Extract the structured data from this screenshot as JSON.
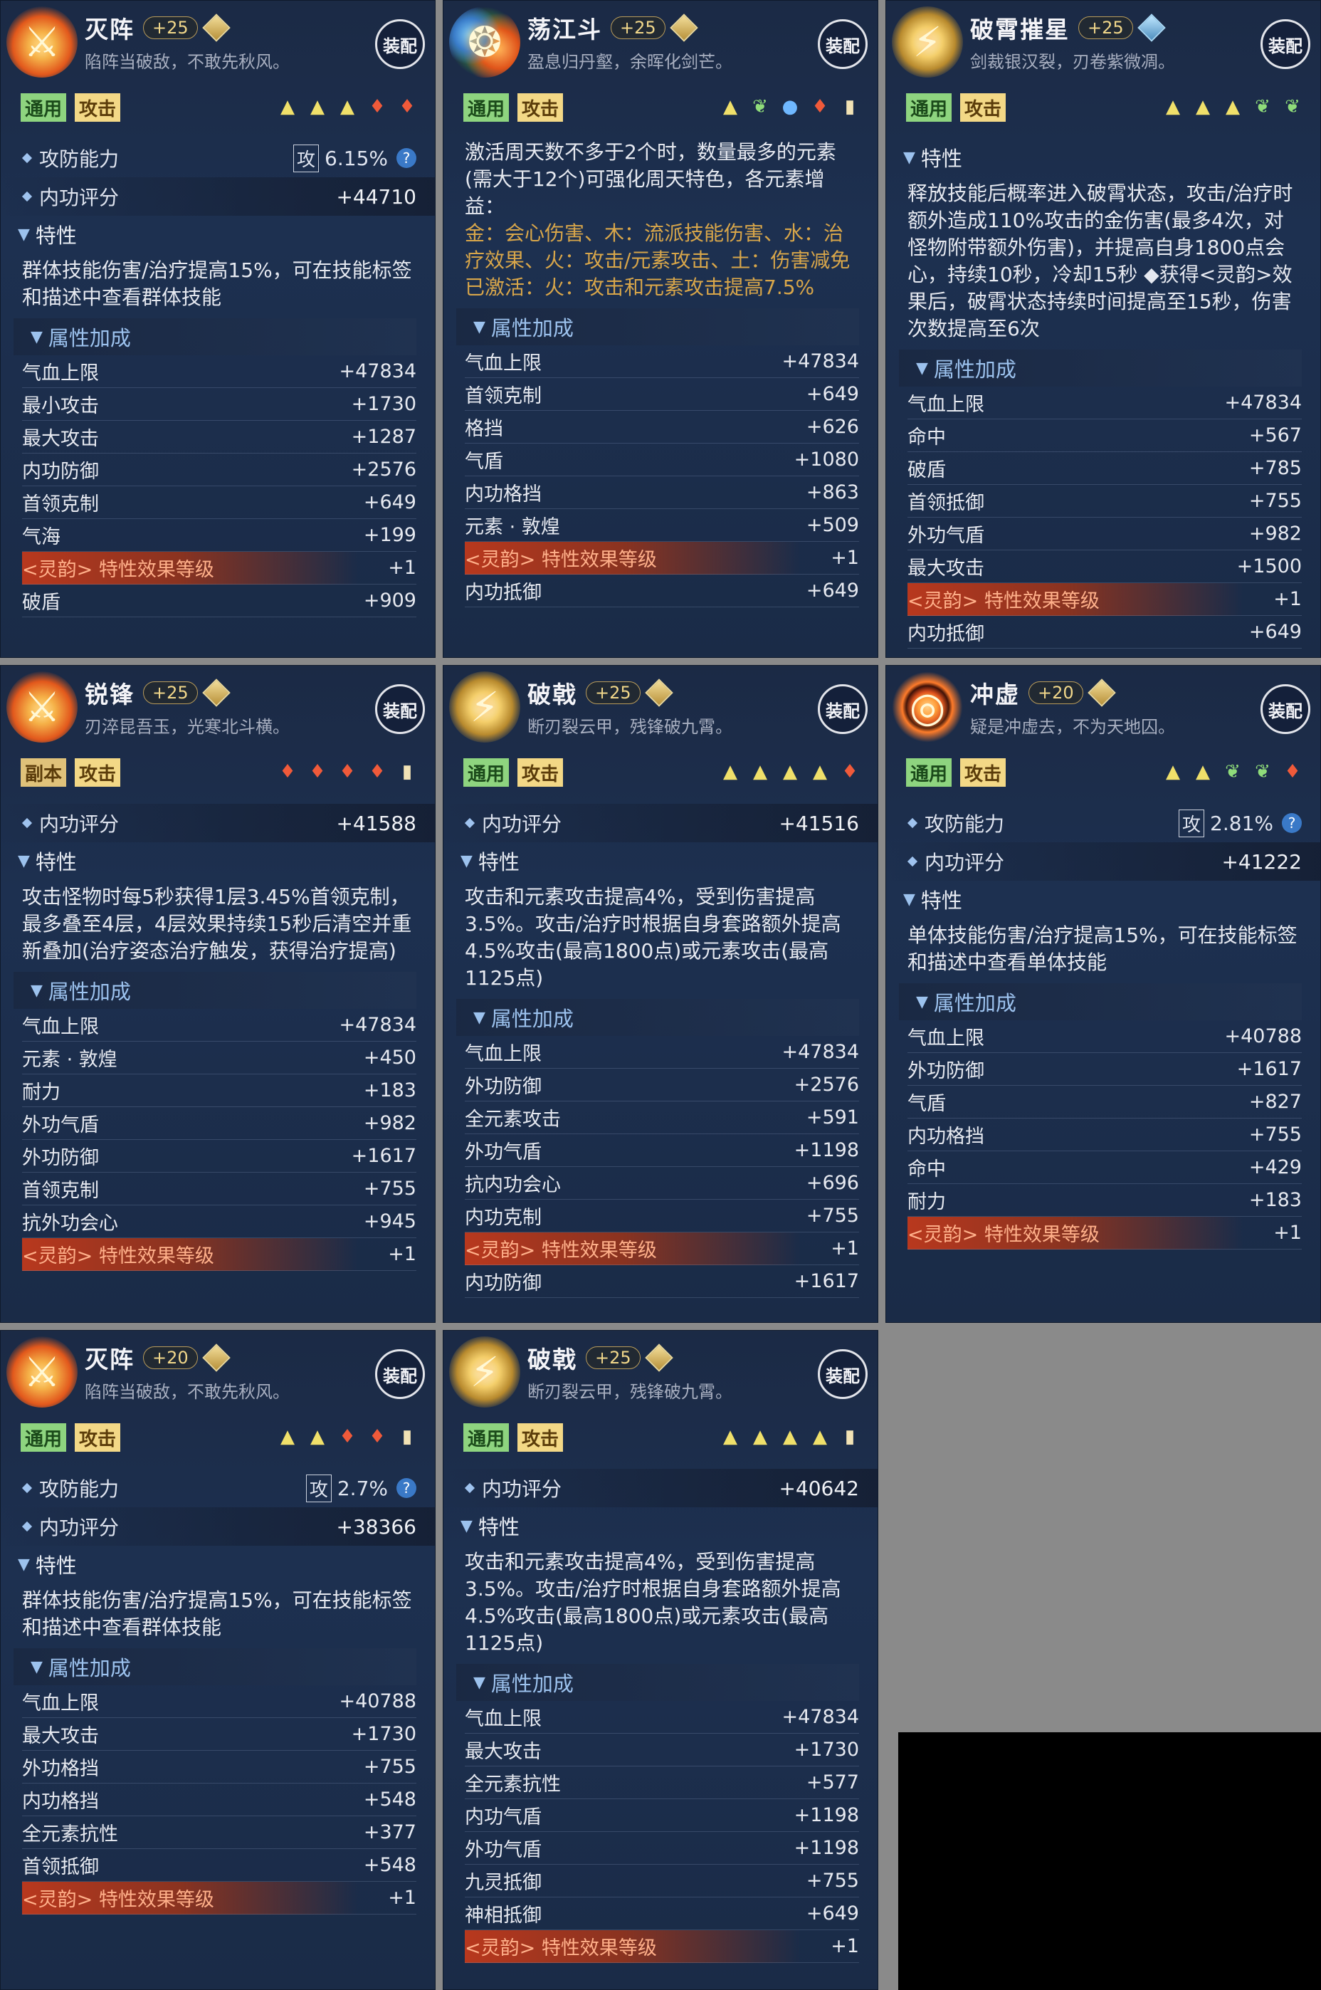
{
  "cards": [
    {
      "name": "灭阵",
      "level": "+25",
      "desc": "陷阵当破敌，不敢先秋风。",
      "equip": "装配",
      "tags": [
        "通用",
        "攻击"
      ],
      "icons": [
        "tri",
        "tri",
        "tri",
        "fire",
        "fire"
      ],
      "atk_ability": {
        "label": "攻防能力",
        "box": "攻",
        "value": "6.15%"
      },
      "score": {
        "label": "内功评分",
        "value": "+44710"
      },
      "trait_label": "特性",
      "trait_text": "群体技能伤害/治疗提高15%，可在技能标签和描述中查看群体技能",
      "bonus_label": "属性加成",
      "attrs": [
        {
          "k": "气血上限",
          "v": "+47834"
        },
        {
          "k": "最小攻击",
          "v": "+1730"
        },
        {
          "k": "最大攻击",
          "v": "+1287"
        },
        {
          "k": "内功防御",
          "v": "+2576"
        },
        {
          "k": "首领克制",
          "v": "+649"
        },
        {
          "k": "气海",
          "v": "+199"
        },
        {
          "k": "<灵韵> 特性效果等级",
          "v": "+1",
          "fx": true
        },
        {
          "k": "破盾",
          "v": "+909"
        }
      ]
    },
    {
      "name": "荡江斗",
      "level": "+25",
      "desc": "盈息归丹壑，余晖化剑芒。",
      "equip": "装配",
      "tags": [
        "通用",
        "攻击"
      ],
      "icons": [
        "tri",
        "leaf",
        "drop",
        "fire",
        "stone"
      ],
      "trait_text_lines": [
        "激活周天数不多于2个时，数量最多的元素",
        "(需大于12个)可强化周天特色，各元素增益：",
        "金：会心伤害、木：流派技能伤害、水：治疗效果、火：攻击/元素攻击、土：伤害减免",
        "已激活：火：攻击和元素攻击提高7.5%"
      ],
      "bonus_label": "属性加成",
      "attrs": [
        {
          "k": "气血上限",
          "v": "+47834"
        },
        {
          "k": "首领克制",
          "v": "+649"
        },
        {
          "k": "格挡",
          "v": "+626"
        },
        {
          "k": "气盾",
          "v": "+1080"
        },
        {
          "k": "内功格挡",
          "v": "+863"
        },
        {
          "k": "元素 · 敦煌",
          "v": "+509"
        },
        {
          "k": "<灵韵> 特性效果等级",
          "v": "+1",
          "fx": true
        },
        {
          "k": "内功抵御",
          "v": "+649"
        }
      ]
    },
    {
      "name": "破霄摧星",
      "level": "+25",
      "desc": "剑裁银汉裂，刃卷紫微凋。",
      "equip": "装配",
      "tags": [
        "通用",
        "攻击"
      ],
      "icons": [
        "tri",
        "tri",
        "tri",
        "leaf",
        "leaf"
      ],
      "trait_label": "特性",
      "trait_text": "释放技能后概率进入破霄状态，攻击/治疗时额外造成110%攻击的金伤害(最多4次，对怪物附带额外伤害)，并提高自身1800点会心，持续10秒，冷却15秒 ◆获得<灵韵>效果后，破霄状态持续时间提高至15秒，伤害次数提高至6次",
      "bonus_label": "属性加成",
      "attrs": [
        {
          "k": "气血上限",
          "v": "+47834"
        },
        {
          "k": "命中",
          "v": "+567"
        },
        {
          "k": "破盾",
          "v": "+785"
        },
        {
          "k": "首领抵御",
          "v": "+755"
        },
        {
          "k": "外功气盾",
          "v": "+982"
        },
        {
          "k": "最大攻击",
          "v": "+1500"
        },
        {
          "k": "<灵韵> 特性效果等级",
          "v": "+1",
          "fx": true
        },
        {
          "k": "内功抵御",
          "v": "+649"
        }
      ]
    },
    {
      "name": "锐锋",
      "level": "+25",
      "desc": "刃淬昆吾玉，光寒北斗横。",
      "equip": "装配",
      "tags": [
        "副本",
        "攻击"
      ],
      "icons": [
        "fire",
        "fire",
        "fire",
        "fire",
        "stone"
      ],
      "score": {
        "label": "内功评分",
        "value": "+41588"
      },
      "trait_label": "特性",
      "trait_text": "攻击怪物时每5秒获得1层3.45%首领克制，最多叠至4层，4层效果持续15秒后清空并重新叠加(治疗姿态治疗触发，获得治疗提高)",
      "bonus_label": "属性加成",
      "attrs": [
        {
          "k": "气血上限",
          "v": "+47834"
        },
        {
          "k": "元素 · 敦煌",
          "v": "+450"
        },
        {
          "k": "耐力",
          "v": "+183"
        },
        {
          "k": "外功气盾",
          "v": "+982"
        },
        {
          "k": "外功防御",
          "v": "+1617"
        },
        {
          "k": "首领克制",
          "v": "+755"
        },
        {
          "k": "抗外功会心",
          "v": "+945"
        },
        {
          "k": "<灵韵> 特性效果等级",
          "v": "+1",
          "fx": true
        }
      ]
    },
    {
      "name": "破戟",
      "level": "+25",
      "desc": "断刃裂云甲，残锋破九霄。",
      "equip": "装配",
      "tags": [
        "通用",
        "攻击"
      ],
      "icons": [
        "tri",
        "tri",
        "tri",
        "tri",
        "fire"
      ],
      "score": {
        "label": "内功评分",
        "value": "+41516"
      },
      "trait_label": "特性",
      "trait_text": "攻击和元素攻击提高4%，受到伤害提高3.5%。攻击/治疗时根据自身套路额外提高4.5%攻击(最高1800点)或元素攻击(最高1125点)",
      "bonus_label": "属性加成",
      "attrs": [
        {
          "k": "气血上限",
          "v": "+47834"
        },
        {
          "k": "外功防御",
          "v": "+2576"
        },
        {
          "k": "全元素攻击",
          "v": "+591"
        },
        {
          "k": "外功气盾",
          "v": "+1198"
        },
        {
          "k": "抗内功会心",
          "v": "+696"
        },
        {
          "k": "内功克制",
          "v": "+755"
        },
        {
          "k": "<灵韵> 特性效果等级",
          "v": "+1",
          "fx": true
        },
        {
          "k": "内功防御",
          "v": "+1617"
        }
      ]
    },
    {
      "name": "冲虚",
      "level": "+20",
      "desc": "疑是冲虚去，不为天地囚。",
      "equip": "装配",
      "tags": [
        "通用",
        "攻击"
      ],
      "icons": [
        "tri",
        "tri",
        "leaf",
        "leaf",
        "fire"
      ],
      "atk_ability": {
        "label": "攻防能力",
        "box": "攻",
        "value": "2.81%"
      },
      "score": {
        "label": "内功评分",
        "value": "+41222"
      },
      "trait_label": "特性",
      "trait_text": "单体技能伤害/治疗提高15%，可在技能标签和描述中查看单体技能",
      "bonus_label": "属性加成",
      "attrs": [
        {
          "k": "气血上限",
          "v": "+40788"
        },
        {
          "k": "外功防御",
          "v": "+1617"
        },
        {
          "k": "气盾",
          "v": "+827"
        },
        {
          "k": "内功格挡",
          "v": "+755"
        },
        {
          "k": "命中",
          "v": "+429"
        },
        {
          "k": "耐力",
          "v": "+183"
        },
        {
          "k": "<灵韵> 特性效果等级",
          "v": "+1",
          "fx": true
        }
      ]
    },
    {
      "name": "灭阵",
      "level": "+20",
      "desc": "陷阵当破敌，不敢先秋风。",
      "equip": "装配",
      "tags": [
        "通用",
        "攻击"
      ],
      "icons": [
        "tri",
        "tri",
        "fire",
        "fire",
        "stone"
      ],
      "atk_ability": {
        "label": "攻防能力",
        "box": "攻",
        "value": "2.7%"
      },
      "score": {
        "label": "内功评分",
        "value": "+38366"
      },
      "trait_label": "特性",
      "trait_text": "群体技能伤害/治疗提高15%，可在技能标签和描述中查看群体技能",
      "bonus_label": "属性加成",
      "attrs": [
        {
          "k": "气血上限",
          "v": "+40788"
        },
        {
          "k": "最大攻击",
          "v": "+1730"
        },
        {
          "k": "外功格挡",
          "v": "+755"
        },
        {
          "k": "内功格挡",
          "v": "+548"
        },
        {
          "k": "全元素抗性",
          "v": "+377"
        },
        {
          "k": "首领抵御",
          "v": "+548"
        },
        {
          "k": "<灵韵> 特性效果等级",
          "v": "+1",
          "fx": true
        }
      ]
    },
    {
      "name": "破戟",
      "level": "+25",
      "desc": "断刃裂云甲，残锋破九霄。",
      "equip": "装配",
      "tags": [
        "通用",
        "攻击"
      ],
      "icons": [
        "tri",
        "tri",
        "tri",
        "tri",
        "stone"
      ],
      "score": {
        "label": "内功评分",
        "value": "+40642"
      },
      "trait_label": "特性",
      "trait_text": "攻击和元素攻击提高4%，受到伤害提高3.5%。攻击/治疗时根据自身套路额外提高4.5%攻击(最高1800点)或元素攻击(最高1125点)",
      "bonus_label": "属性加成",
      "attrs": [
        {
          "k": "气血上限",
          "v": "+47834"
        },
        {
          "k": "最大攻击",
          "v": "+1730"
        },
        {
          "k": "全元素抗性",
          "v": "+577"
        },
        {
          "k": "内功气盾",
          "v": "+1198"
        },
        {
          "k": "外功气盾",
          "v": "+1198"
        },
        {
          "k": "九灵抵御",
          "v": "+755"
        },
        {
          "k": "神相抵御",
          "v": "+649"
        },
        {
          "k": "<灵韵> 特性效果等级",
          "v": "+1",
          "fx": true
        }
      ]
    }
  ],
  "icon_glyphs": {
    "tri": "▲",
    "fire": "♦",
    "leaf": "❦",
    "drop": "●",
    "stone": "▮"
  }
}
